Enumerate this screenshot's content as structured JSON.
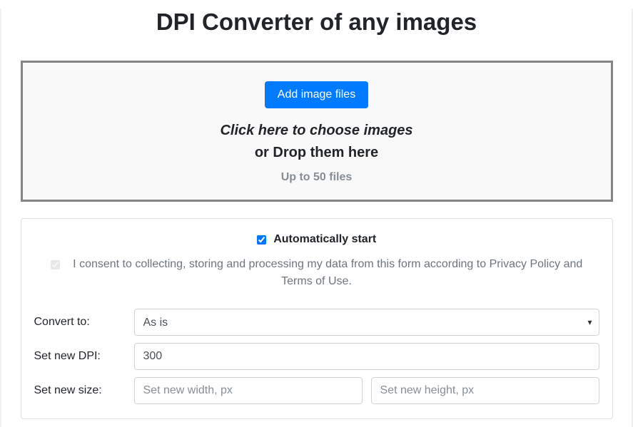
{
  "title": "DPI Converter of any images",
  "dropzone": {
    "add_button": "Add image files",
    "choose_text": "Click here to choose images",
    "drop_text": "or Drop them here",
    "limit_text": "Up to 50 files"
  },
  "settings": {
    "auto_start_label": "Automatically start",
    "auto_start_checked": true,
    "consent_text": "I consent to collecting, storing and processing my data from this form according to Privacy Policy and Terms of Use.",
    "consent_checked": true,
    "convert_label": "Convert to:",
    "convert_selected": "As is",
    "dpi_label": "Set new DPI:",
    "dpi_value": "300",
    "size_label": "Set new size:",
    "width_placeholder": "Set new width, px",
    "height_placeholder": "Set new height, px"
  }
}
